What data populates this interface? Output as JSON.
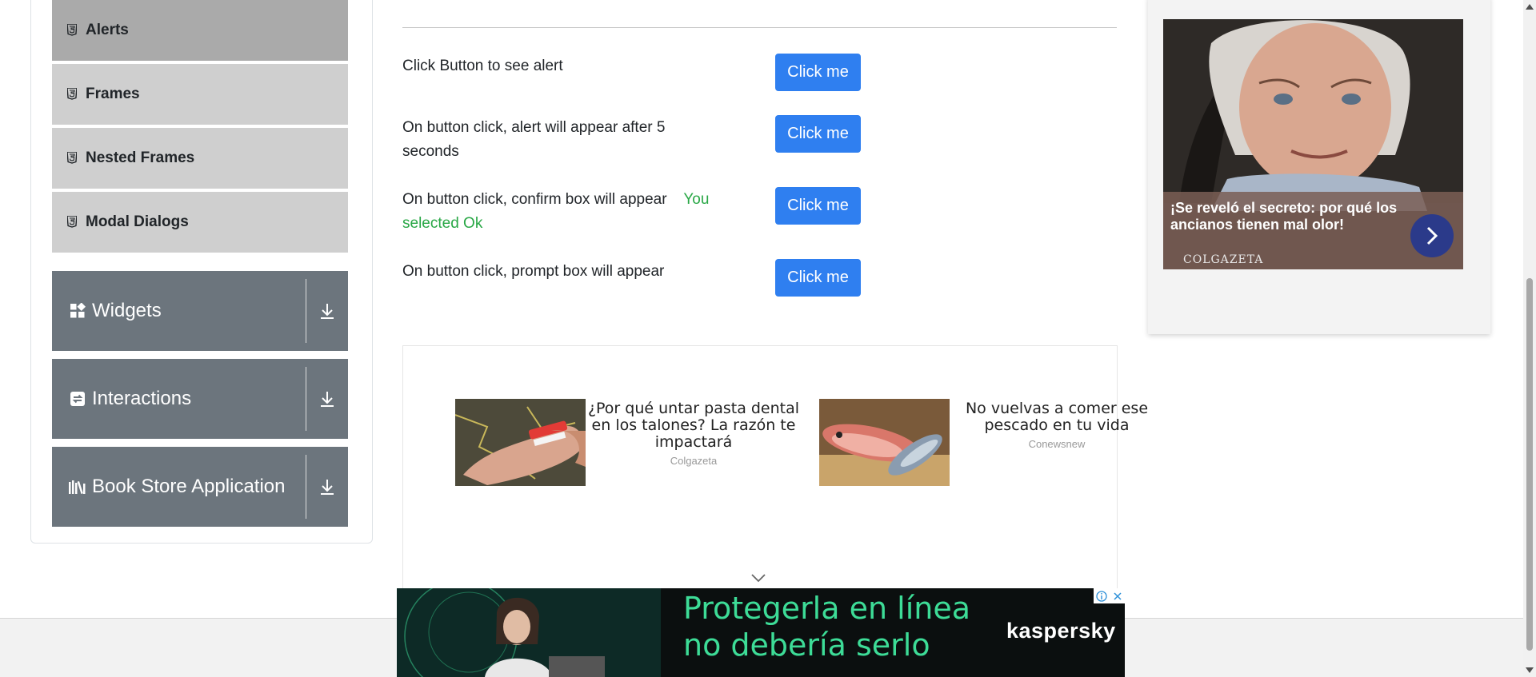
{
  "sidebar": {
    "items": [
      {
        "label": "Alerts",
        "icon": "html5-icon",
        "active": true
      },
      {
        "label": "Frames",
        "icon": "html5-icon",
        "active": false
      },
      {
        "label": "Nested Frames",
        "icon": "html5-icon",
        "active": false
      },
      {
        "label": "Modal Dialogs",
        "icon": "html5-icon",
        "active": false
      }
    ],
    "groups": [
      {
        "label": "Widgets",
        "icon": "widgets-icon"
      },
      {
        "label": "Interactions",
        "icon": "interactions-icon"
      },
      {
        "label": "Book Store Application",
        "icon": "book-store-icon"
      }
    ]
  },
  "main": {
    "rows": [
      {
        "text": "Click Button to see alert",
        "button": "Click me"
      },
      {
        "text": "On button click, alert will appear after 5 seconds",
        "button": "Click me"
      },
      {
        "text": "On button click, confirm box will appear",
        "result": "You selected Ok",
        "button": "Click me"
      },
      {
        "text": "On button click, prompt box will appear",
        "button": "Click me"
      }
    ]
  },
  "native_ads": [
    {
      "headline": "¿Por qué untar pasta dental en los talones? La razón te impactará",
      "source": "Colgazeta"
    },
    {
      "headline": "No vuelvas a comer ese pescado en tu vida",
      "source": "Conewsnew"
    }
  ],
  "right_ad": {
    "headline": "¡Se reveló el secreto: por qué los ancianos tienen mal olor!",
    "source": "COLGAZETA"
  },
  "banner_ad": {
    "slogan_line1": "Protegerla en línea",
    "slogan_line2": "no debería serlo",
    "brand": "kaspersky"
  },
  "colors": {
    "primary_button": "#2f7ff0",
    "result_text": "#28a745",
    "group_header": "#6c757d",
    "active_item": "#aaaaaa",
    "banner_slogan": "#3ddc97"
  }
}
